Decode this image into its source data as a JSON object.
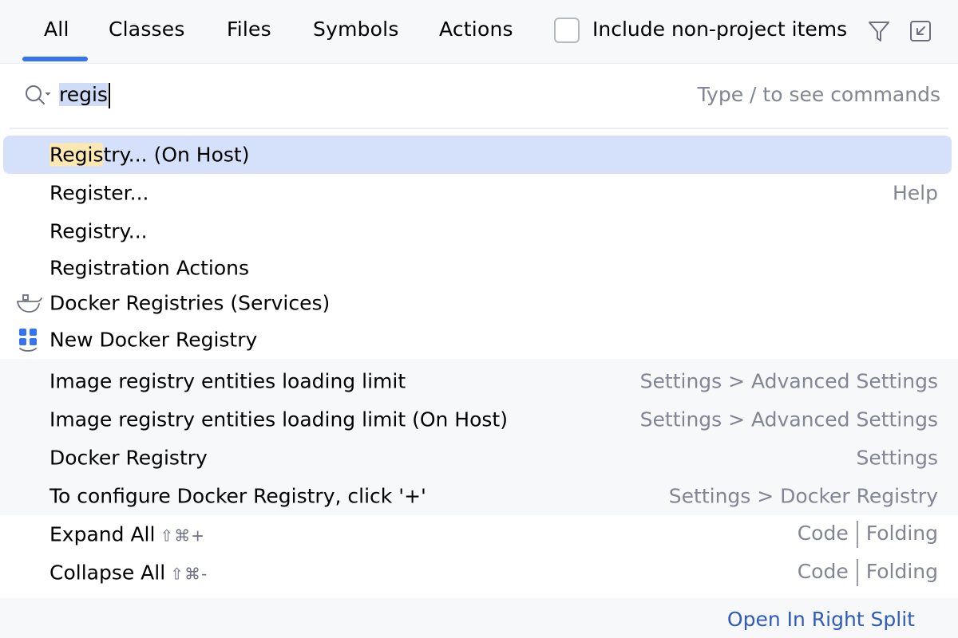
{
  "tabs": [
    {
      "label": "All",
      "active": true
    },
    {
      "label": "Classes"
    },
    {
      "label": "Files"
    },
    {
      "label": "Symbols"
    },
    {
      "label": "Actions"
    }
  ],
  "include_non_project": {
    "label": "Include non-project items",
    "checked": false
  },
  "toolbar_icons": [
    "filter-icon",
    "collapse-window-icon"
  ],
  "search": {
    "value": "regis",
    "hint": "Type / to see commands"
  },
  "results": [
    {
      "highlight": "Regis",
      "rest": "try... (On Host)",
      "right": "",
      "selected": true
    },
    {
      "label": "Register...",
      "right": "Help"
    },
    {
      "label": "Registry...",
      "right": ""
    },
    {
      "label": "Registration Actions",
      "right": ""
    },
    {
      "label": "Docker Registries (Services)",
      "right": "",
      "icon": "docker-icon"
    },
    {
      "label": "New Docker Registry",
      "right": "",
      "icon": "new-registry-icon"
    },
    {
      "label": "Image registry entities loading limit",
      "right": "Settings > Advanced Settings"
    },
    {
      "label": "Image registry entities loading limit (On Host)",
      "right": "Settings > Advanced Settings"
    },
    {
      "label": "Docker Registry",
      "right": "Settings"
    },
    {
      "label": "To configure Docker Registry, click '+'",
      "right": "Settings > Docker Registry"
    },
    {
      "label": "Expand All",
      "shortcut": "⇧⌘+",
      "right_a": "Code",
      "right_b": "Folding"
    },
    {
      "label": "Collapse All",
      "shortcut": "⇧⌘-",
      "right_a": "Code",
      "right_b": "Folding"
    }
  ],
  "footer": {
    "link": "Open In Right Split"
  },
  "colors": {
    "accent": "#3574f0",
    "selection": "#d5e1fa",
    "match_highlight": "#fde9b0"
  }
}
